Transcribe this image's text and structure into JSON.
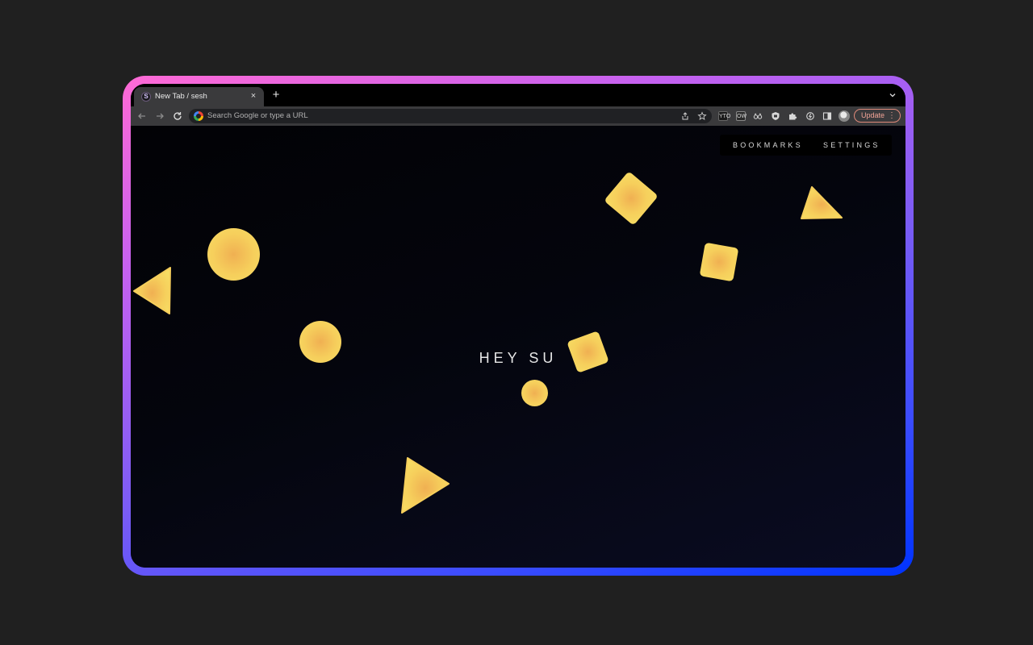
{
  "browser": {
    "tab_title": "New Tab / sesh",
    "tab_favicon_letter": "S",
    "tab_close": "×",
    "new_tab": "+",
    "omnibox_placeholder": "Search Google or type a URL",
    "update_label": "Update",
    "extensions": [
      "YTO",
      "OW",
      "",
      "",
      "",
      ""
    ]
  },
  "page": {
    "nav": {
      "bookmarks": "BOOKMARKS",
      "settings": "SETTINGS"
    },
    "greeting": "HEY SU"
  },
  "colors": {
    "frame_gradient": [
      "#ff6ad5",
      "#7b5cf5",
      "#0033ff"
    ],
    "shape_fill": "#f6cf5c",
    "shape_center": "#f0b052",
    "background": "#202020"
  }
}
